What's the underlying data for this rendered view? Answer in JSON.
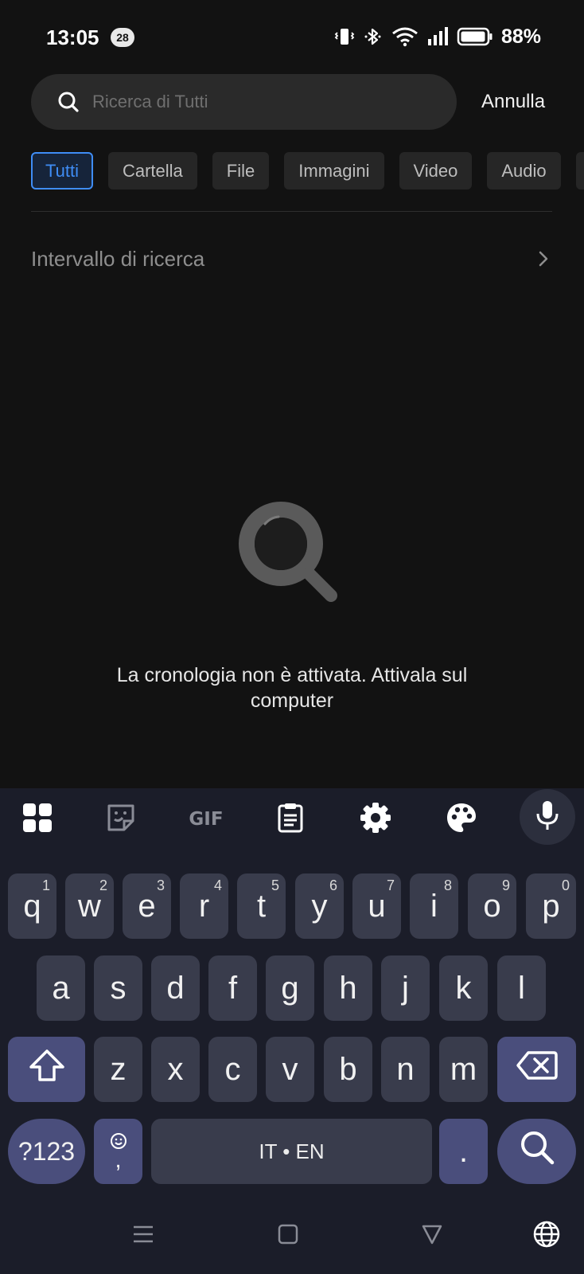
{
  "status_bar": {
    "time": "13:05",
    "notification_count": "28",
    "battery": "88%",
    "icons": [
      "vibrate-icon",
      "bluetooth-icon",
      "wifi-icon",
      "signal-icon",
      "battery-icon"
    ]
  },
  "search": {
    "placeholder": "Ricerca di Tutti",
    "value": "",
    "cancel_label": "Annulla"
  },
  "filters": {
    "chips": [
      {
        "label": "Tutti",
        "active": true
      },
      {
        "label": "Cartella",
        "active": false
      },
      {
        "label": "File",
        "active": false
      },
      {
        "label": "Immagini",
        "active": false
      },
      {
        "label": "Video",
        "active": false
      },
      {
        "label": "Audio",
        "active": false
      },
      {
        "label": "",
        "active": false
      }
    ]
  },
  "range": {
    "label": "Intervallo di ricerca"
  },
  "empty_state": {
    "message": "La cronologia non è attivata. Attivala sul computer"
  },
  "keyboard": {
    "toolbar": [
      "apps-icon",
      "sticker-icon",
      "gif-icon",
      "clipboard-icon",
      "settings-icon",
      "palette-icon",
      "mic-icon"
    ],
    "row1": [
      {
        "key": "q",
        "hint": "1"
      },
      {
        "key": "w",
        "hint": "2"
      },
      {
        "key": "e",
        "hint": "3"
      },
      {
        "key": "r",
        "hint": "4"
      },
      {
        "key": "t",
        "hint": "5"
      },
      {
        "key": "y",
        "hint": "6"
      },
      {
        "key": "u",
        "hint": "7"
      },
      {
        "key": "i",
        "hint": "8"
      },
      {
        "key": "o",
        "hint": "9"
      },
      {
        "key": "p",
        "hint": "0"
      }
    ],
    "row2": [
      "a",
      "s",
      "d",
      "f",
      "g",
      "h",
      "j",
      "k",
      "l"
    ],
    "row3": [
      "z",
      "x",
      "c",
      "v",
      "b",
      "n",
      "m"
    ],
    "symbols_label": "?123",
    "comma_label": ",",
    "space_label": "IT • EN",
    "period_label": "."
  },
  "colors": {
    "accent": "#3f8df5",
    "background": "#121212",
    "keyboard_bg": "#1b1d29",
    "key_bg": "#393c4c",
    "func_key_bg": "#4a4e7c"
  }
}
